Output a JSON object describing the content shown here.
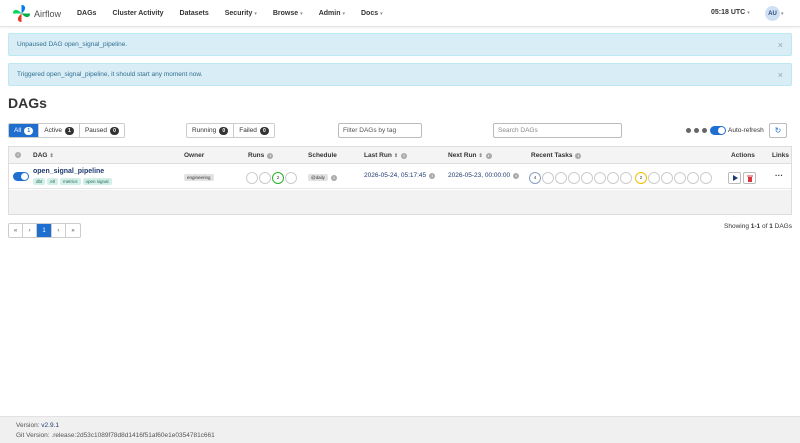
{
  "nav": {
    "brand": "Airflow",
    "items": [
      {
        "label": "DAGs",
        "dropdown": false
      },
      {
        "label": "Cluster Activity",
        "dropdown": false
      },
      {
        "label": "Datasets",
        "dropdown": false
      },
      {
        "label": "Security",
        "dropdown": true
      },
      {
        "label": "Browse",
        "dropdown": true
      },
      {
        "label": "Admin",
        "dropdown": true
      },
      {
        "label": "Docs",
        "dropdown": true
      }
    ],
    "clock": "05:18 UTC",
    "user_initials": "AU"
  },
  "alerts": [
    {
      "text": "Unpaused DAG open_signal_pipeline."
    },
    {
      "text": "Triggered open_signal_pipeline, it should start any moment now."
    }
  ],
  "page_title": "DAGs",
  "status_filters": [
    {
      "label": "All",
      "count": "1",
      "active": true
    },
    {
      "label": "Active",
      "count": "1",
      "active": false
    },
    {
      "label": "Paused",
      "count": "0",
      "active": false
    }
  ],
  "run_filters": [
    {
      "label": "Running",
      "count": "0"
    },
    {
      "label": "Failed",
      "count": "0"
    }
  ],
  "tag_filter_placeholder": "Filter DAGs by tag",
  "search_placeholder": "Search DAGs",
  "auto_refresh_label": "Auto-refresh",
  "table": {
    "headers": {
      "dag": "DAG",
      "owner": "Owner",
      "runs": "Runs",
      "schedule": "Schedule",
      "last_run": "Last Run",
      "next_run": "Next Run",
      "recent_tasks": "Recent Tasks",
      "actions": "Actions",
      "links": "Links"
    },
    "rows": [
      {
        "dag_id": "open_signal_pipeline",
        "tags": [
          "dbt",
          "etl",
          "metrics",
          "open signal"
        ],
        "owner": "engineering",
        "runs_running_count": "2",
        "schedule": "@daily",
        "last_run": "2026-05-24, 05:17:45",
        "next_run": "2026-05-23, 00:00:00",
        "recent_tasks_queued_count": "4",
        "recent_tasks_running_count": "2",
        "links_more": "···"
      }
    ]
  },
  "pagination": {
    "first": "«",
    "prev": "‹",
    "current": "1",
    "next": "›",
    "last": "»"
  },
  "showing": {
    "prefix": "Showing ",
    "range": "1-1",
    "of": " of ",
    "total": "1",
    "suffix": " DAGs"
  },
  "footer": {
    "version_label": "Version: ",
    "version": "v2.9.1",
    "git_label": "Git Version: ",
    "git_version": ".release:2d53c1089f78d8d1416f51af60e1e0354781c661"
  },
  "colors": {
    "accent": "#1f6fd1",
    "running": "#29b229",
    "queued": "#8c8c8c",
    "up_for_retry": "#f0c000",
    "delete": "#d9363e"
  }
}
